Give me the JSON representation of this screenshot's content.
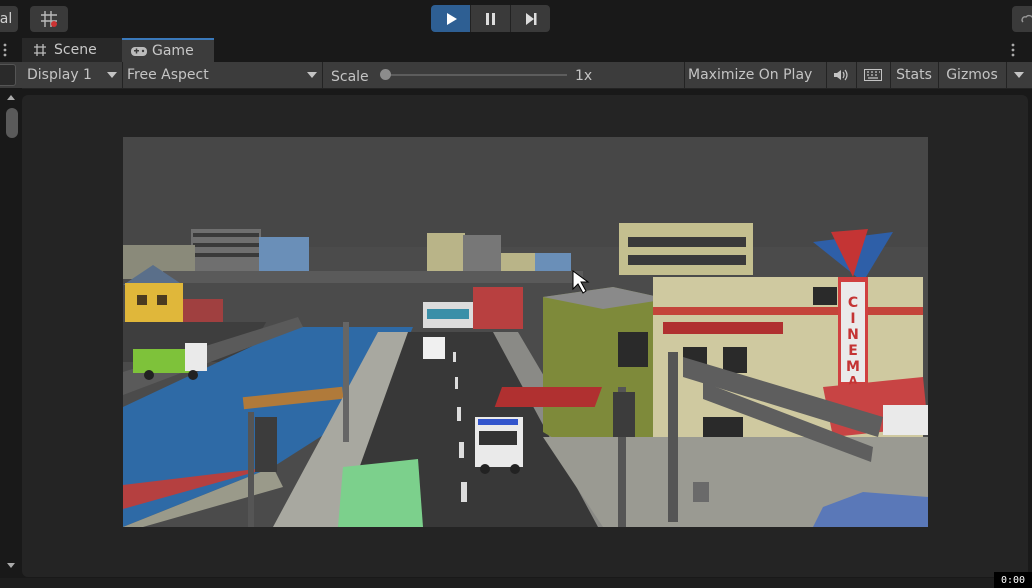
{
  "toolbar": {
    "left_label": "al",
    "play_icon": "play-icon",
    "pause_icon": "pause-icon",
    "step_icon": "step-icon"
  },
  "tabs": [
    {
      "label": "Scene",
      "icon": "scene-grid-icon"
    },
    {
      "label": "Game",
      "icon": "gamepad-icon"
    }
  ],
  "controls": {
    "display": "Display 1",
    "aspect": "Free Aspect",
    "scale_label": "Scale",
    "scale_value": "1x",
    "maximize": "Maximize On Play",
    "stats": "Stats",
    "gizmos": "Gizmos"
  },
  "scene": {
    "cinema_sign": "CINEMA"
  },
  "corner_badge": "0:00",
  "colors": {
    "play_active": "#2e5f93",
    "panel_bg": "#3c3c3c",
    "sky": "#4a4a4a",
    "water": "#2e6aa6"
  }
}
